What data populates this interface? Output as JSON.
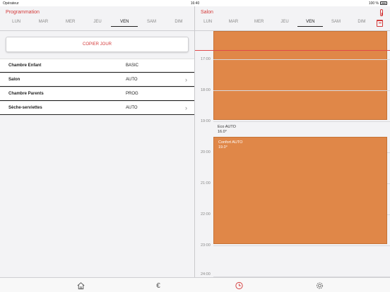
{
  "status": {
    "carrier": "Opérateur",
    "time": "16:40",
    "battery": "100 %"
  },
  "left": {
    "title": "Programmation",
    "days": [
      "LUN",
      "MAR",
      "MER",
      "JEU",
      "VEN",
      "SAM",
      "DIM"
    ],
    "active_day": "VEN",
    "copy_button": "COPIER JOUR",
    "rooms": [
      {
        "name": "Chambre Enfant",
        "mode": "BASIC",
        "chevron": false
      },
      {
        "name": "Salon",
        "mode": "AUTO",
        "chevron": true
      },
      {
        "name": "Chambre Parents",
        "mode": "PROG",
        "chevron": false
      },
      {
        "name": "Sèche-serviettes",
        "mode": "AUTO",
        "chevron": true
      }
    ]
  },
  "right": {
    "title": "Salon",
    "days": [
      "LUN",
      "MAR",
      "MER",
      "JEU",
      "VEN",
      "SAM",
      "DIM"
    ],
    "active_day": "VEN",
    "hours": [
      "17:00",
      "18:00",
      "19:00",
      "20:00",
      "21:00",
      "22:00",
      "23:00",
      "24:00"
    ],
    "eco": {
      "label": "Eco AUTO",
      "temp": "16.0°"
    },
    "confort": {
      "label": "Confort AUTO",
      "temp": "19.0°"
    }
  },
  "tabs": [
    "home-icon",
    "euro-icon",
    "clock-icon",
    "gear-icon"
  ],
  "colors": {
    "accent": "#d43a3a",
    "block": "#e08748"
  }
}
